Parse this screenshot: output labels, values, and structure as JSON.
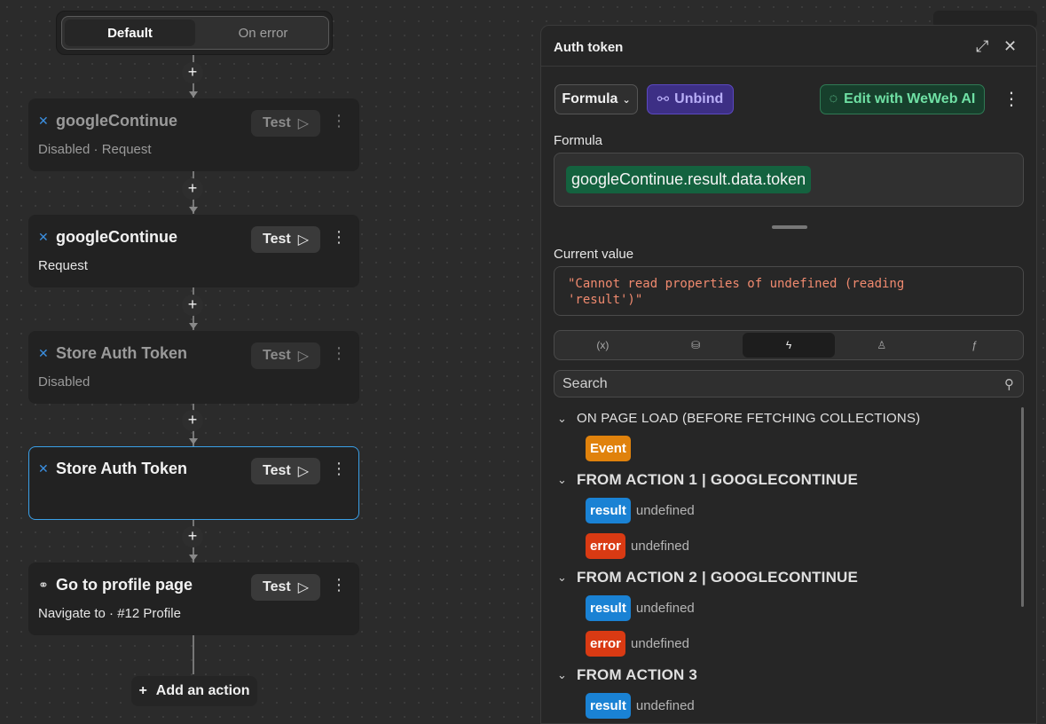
{
  "workflow": {
    "tabs": [
      {
        "label": "Default",
        "active": true
      },
      {
        "label": "On error",
        "active": false
      }
    ],
    "cards": [
      {
        "title": "googleContinue",
        "subtitle": "Disabled · Request",
        "test_label": "Test",
        "disabled": true,
        "icon": "request-icon"
      },
      {
        "title": "googleContinue",
        "subtitle": "Request",
        "test_label": "Test",
        "disabled": false,
        "icon": "request-icon"
      },
      {
        "title": "Store Auth Token",
        "subtitle": "Disabled",
        "test_label": "Test",
        "disabled": true,
        "icon": "variable-icon"
      },
      {
        "title": "Store Auth Token",
        "subtitle": "",
        "test_label": "Test",
        "disabled": false,
        "selected": true,
        "icon": "variable-icon"
      },
      {
        "title": "Go to profile page",
        "subtitle": "Navigate to  · #12 Profile",
        "test_label": "Test",
        "disabled": false,
        "icon": "link-icon"
      }
    ],
    "add_action_label": "Add an action"
  },
  "panel": {
    "title": "Auth token",
    "formula_dropdown_label": "Formula",
    "unbind_label": "Unbind",
    "ai_button_label": "Edit with WeWeb AI",
    "formula_label": "Formula",
    "formula_value": "googleContinue.result.data.token",
    "current_value_label": "Current value",
    "current_value": "\"Cannot read properties of undefined (reading\n'result')\"",
    "tabs": [
      {
        "icon": "variable-x-icon",
        "glyph": "(x)",
        "active": false
      },
      {
        "icon": "database-icon",
        "glyph": "⛁",
        "active": false
      },
      {
        "icon": "lightning-icon",
        "glyph": "ϟ",
        "active": true
      },
      {
        "icon": "user-icon",
        "glyph": "♙",
        "active": false
      },
      {
        "icon": "function-icon",
        "glyph": "ƒ",
        "active": false
      }
    ],
    "search_placeholder": "Search",
    "sections": [
      {
        "title": "ON PAGE LOAD (BEFORE FETCHING COLLECTIONS)",
        "items": [
          {
            "tag": "Event",
            "value": ""
          }
        ]
      },
      {
        "title": "FROM ACTION 1 | GOOGLECONTINUE",
        "items": [
          {
            "tag": "result",
            "value": "undefined"
          },
          {
            "tag": "error",
            "value": "undefined"
          }
        ]
      },
      {
        "title": "FROM ACTION 2 | GOOGLECONTINUE",
        "items": [
          {
            "tag": "result",
            "value": "undefined"
          },
          {
            "tag": "error",
            "value": "undefined"
          }
        ]
      },
      {
        "title": "FROM ACTION 3",
        "items": [
          {
            "tag": "result",
            "value": "undefined"
          }
        ]
      }
    ]
  },
  "colors": {
    "accent_selected": "#3aa0e8",
    "unbind_bg": "#3d2f85",
    "ai_bg": "#173f2c",
    "formula_token_bg": "#14623f",
    "event_pill": "#e0820c",
    "result_pill": "#1a82d4",
    "error_pill": "#d93a13",
    "error_text": "#f08a6f"
  }
}
